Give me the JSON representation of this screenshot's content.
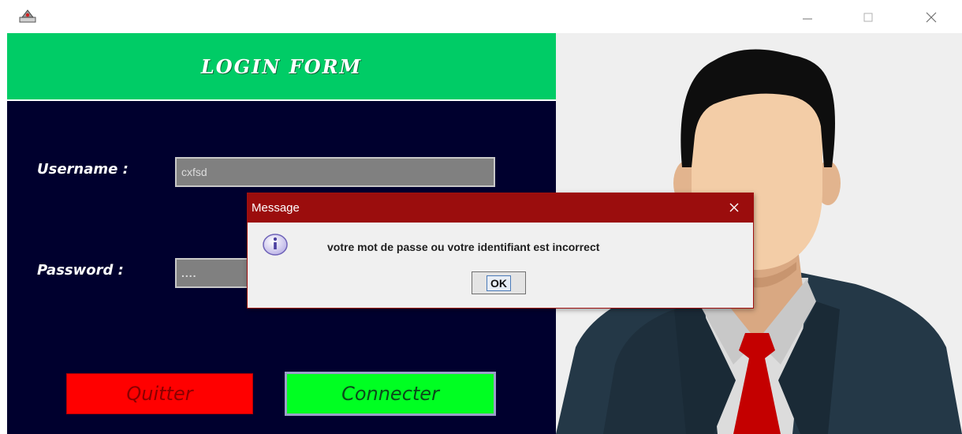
{
  "window": {
    "icons": {
      "app": "java-cup-icon",
      "minimize": "minimize-icon",
      "maximize": "maximize-icon",
      "close": "close-icon"
    }
  },
  "form": {
    "title": "LOGIN FORM",
    "username_label": "Username :",
    "username_value": "cxfsd",
    "password_label": "Password :",
    "password_value": "....",
    "quit_label": "Quitter",
    "connect_label": "Connecter"
  },
  "dialog": {
    "title": "Message",
    "message": "votre mot de passe ou votre identifiant est incorrect",
    "ok_label": "OK",
    "icon": "info-icon"
  },
  "illustration": {
    "subject": "businessman-avatar"
  },
  "colors": {
    "header_green": "#00cc66",
    "panel_navy": "#00002e",
    "quit_red": "#ff0000",
    "connect_green": "#00ff22",
    "dialog_titlebar": "#9b0d0d",
    "tie_red": "#c40000",
    "suit": "#243847"
  }
}
